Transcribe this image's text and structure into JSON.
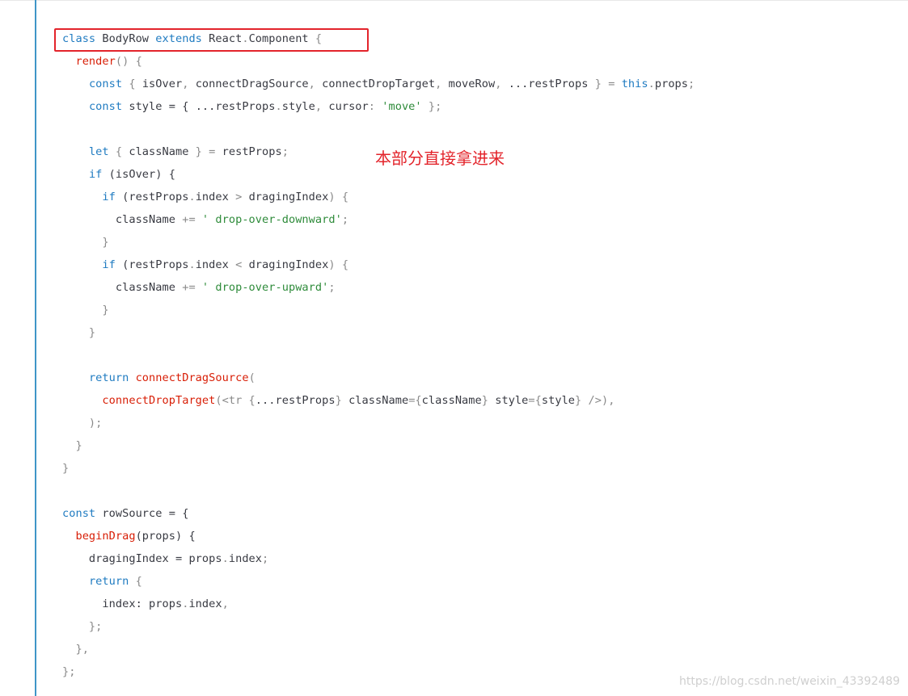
{
  "code": {
    "lines": [
      [
        [
          "class",
          "kw"
        ],
        [
          " BodyRow ",
          "id"
        ],
        [
          "extends",
          "kw"
        ],
        [
          " React",
          "id"
        ],
        [
          ".",
          "pn"
        ],
        [
          "Component",
          "id"
        ],
        [
          " {",
          "pn"
        ]
      ],
      [
        [
          "  ",
          "id"
        ],
        [
          "render",
          "fn"
        ],
        [
          "() {",
          "pn"
        ]
      ],
      [
        [
          "    ",
          "id"
        ],
        [
          "const",
          "kw"
        ],
        [
          " { ",
          "pn"
        ],
        [
          "isOver",
          "id"
        ],
        [
          ", ",
          "pn"
        ],
        [
          "connectDragSource",
          "id"
        ],
        [
          ", ",
          "pn"
        ],
        [
          "connectDropTarget",
          "id"
        ],
        [
          ", ",
          "pn"
        ],
        [
          "moveRow",
          "id"
        ],
        [
          ", ",
          "pn"
        ],
        [
          "...restProps",
          "id"
        ],
        [
          " } = ",
          "pn"
        ],
        [
          "this",
          "kw"
        ],
        [
          ".",
          "pn"
        ],
        [
          "props",
          "id"
        ],
        [
          ";",
          "pn"
        ]
      ],
      [
        [
          "    ",
          "id"
        ],
        [
          "const",
          "kw"
        ],
        [
          " style = { ",
          "id"
        ],
        [
          "...restProps",
          "id"
        ],
        [
          ".",
          "pn"
        ],
        [
          "style",
          "id"
        ],
        [
          ", ",
          "pn"
        ],
        [
          "cursor",
          "id"
        ],
        [
          ": ",
          "pn"
        ],
        [
          "'move'",
          "str"
        ],
        [
          " };",
          "pn"
        ]
      ],
      [
        [
          "",
          "id"
        ]
      ],
      [
        [
          "    ",
          "id"
        ],
        [
          "let",
          "kw"
        ],
        [
          " { ",
          "pn"
        ],
        [
          "className",
          "id"
        ],
        [
          " } = ",
          "pn"
        ],
        [
          "restProps",
          "id"
        ],
        [
          ";",
          "pn"
        ]
      ],
      [
        [
          "    ",
          "id"
        ],
        [
          "if",
          "kw"
        ],
        [
          " (isOver) {",
          "id"
        ]
      ],
      [
        [
          "      ",
          "id"
        ],
        [
          "if",
          "kw"
        ],
        [
          " (restProps",
          "id"
        ],
        [
          ".",
          "pn"
        ],
        [
          "index",
          "id"
        ],
        [
          " > ",
          "pn"
        ],
        [
          "dragingIndex",
          "id"
        ],
        [
          ") {",
          "pn"
        ]
      ],
      [
        [
          "        className ",
          "id"
        ],
        [
          "+=",
          "pn"
        ],
        [
          " ",
          "id"
        ],
        [
          "' drop-over-downward'",
          "str"
        ],
        [
          ";",
          "pn"
        ]
      ],
      [
        [
          "      }",
          "pn"
        ]
      ],
      [
        [
          "      ",
          "id"
        ],
        [
          "if",
          "kw"
        ],
        [
          " (restProps",
          "id"
        ],
        [
          ".",
          "pn"
        ],
        [
          "index",
          "id"
        ],
        [
          " < ",
          "pn"
        ],
        [
          "dragingIndex",
          "id"
        ],
        [
          ") {",
          "pn"
        ]
      ],
      [
        [
          "        className ",
          "id"
        ],
        [
          "+=",
          "pn"
        ],
        [
          " ",
          "id"
        ],
        [
          "' drop-over-upward'",
          "str"
        ],
        [
          ";",
          "pn"
        ]
      ],
      [
        [
          "      }",
          "pn"
        ]
      ],
      [
        [
          "    }",
          "pn"
        ]
      ],
      [
        [
          "",
          "id"
        ]
      ],
      [
        [
          "    ",
          "id"
        ],
        [
          "return",
          "kw"
        ],
        [
          " ",
          "id"
        ],
        [
          "connectDragSource",
          "fn"
        ],
        [
          "(",
          "pn"
        ]
      ],
      [
        [
          "      ",
          "id"
        ],
        [
          "connectDropTarget",
          "fn"
        ],
        [
          "(<tr {",
          "pn"
        ],
        [
          "...restProps",
          "id"
        ],
        [
          "} ",
          "pn"
        ],
        [
          "className",
          "id"
        ],
        [
          "={",
          "pn"
        ],
        [
          "className",
          "id"
        ],
        [
          "} ",
          "pn"
        ],
        [
          "style",
          "id"
        ],
        [
          "={",
          "pn"
        ],
        [
          "style",
          "id"
        ],
        [
          "} />),",
          "pn"
        ]
      ],
      [
        [
          "    );",
          "pn"
        ]
      ],
      [
        [
          "  }",
          "pn"
        ]
      ],
      [
        [
          "}",
          "pn"
        ]
      ],
      [
        [
          "",
          "id"
        ]
      ],
      [
        [
          "const",
          "kw"
        ],
        [
          " rowSource = {",
          "id"
        ]
      ],
      [
        [
          "  ",
          "id"
        ],
        [
          "beginDrag",
          "fn"
        ],
        [
          "(props) {",
          "id"
        ]
      ],
      [
        [
          "    dragingIndex = props",
          "id"
        ],
        [
          ".",
          "pn"
        ],
        [
          "index",
          "id"
        ],
        [
          ";",
          "pn"
        ]
      ],
      [
        [
          "    ",
          "id"
        ],
        [
          "return",
          "kw"
        ],
        [
          " {",
          "pn"
        ]
      ],
      [
        [
          "      index: props",
          "id"
        ],
        [
          ".",
          "pn"
        ],
        [
          "index",
          "id"
        ],
        [
          ",",
          "pn"
        ]
      ],
      [
        [
          "    };",
          "pn"
        ]
      ],
      [
        [
          "  },",
          "pn"
        ]
      ],
      [
        [
          "};",
          "pn"
        ]
      ]
    ]
  },
  "annotation": {
    "text": "本部分直接拿进来"
  },
  "watermark": {
    "text": "https://blog.csdn.net/weixin_43392489"
  },
  "colors": {
    "keyword": "#1f7bc1",
    "function": "#d81e06",
    "string": "#2e8b3a",
    "punctuation": "#8a8a8a",
    "identifier": "#383a42",
    "highlight_box": "#e3242b",
    "left_rule": "#3f96c8"
  }
}
